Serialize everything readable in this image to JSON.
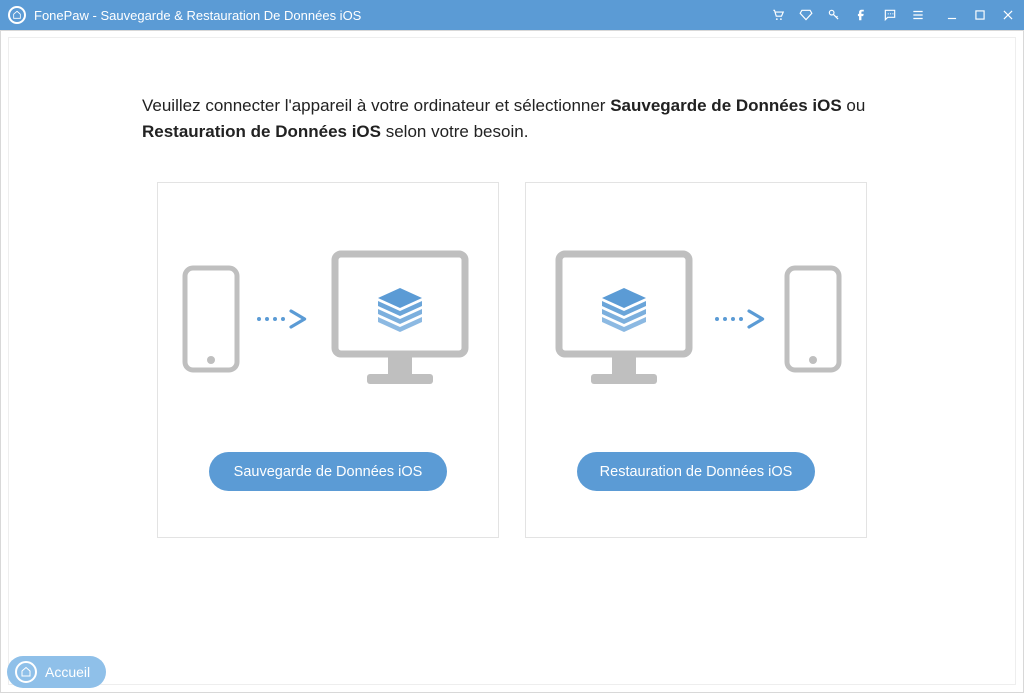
{
  "titlebar": {
    "title": "FonePaw - Sauvegarde & Restauration De Données iOS"
  },
  "instruction": {
    "prefix": "Veuillez connecter l'appareil à votre ordinateur et sélectionner ",
    "bold1": "Sauvegarde de Données iOS",
    "middle": " ou ",
    "bold2": "Restauration de Données iOS",
    "suffix": " selon votre besoin."
  },
  "cards": {
    "backup": {
      "button": "Sauvegarde de Données iOS"
    },
    "restore": {
      "button": "Restauration de Données iOS"
    }
  },
  "footer": {
    "home": "Accueil"
  }
}
